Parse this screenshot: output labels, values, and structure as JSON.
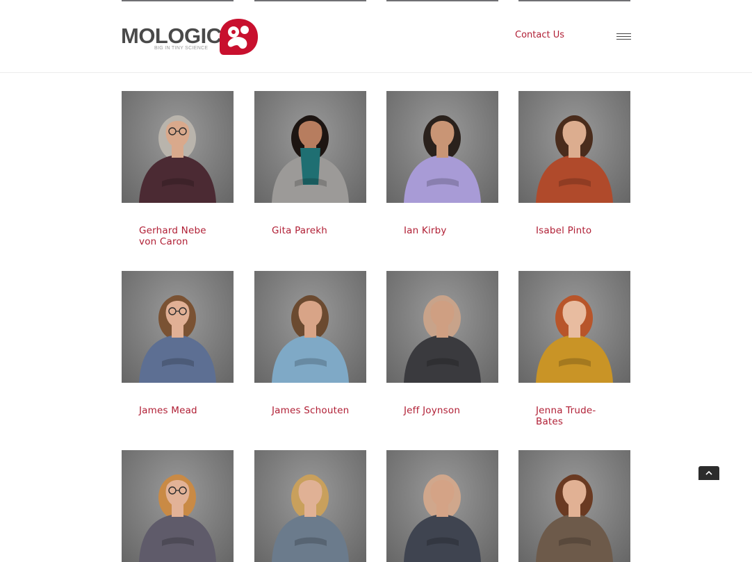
{
  "header": {
    "logo": {
      "wordmark": "MOLOGIC",
      "tagline": "BIG IN TINY SCIENCE",
      "brand_color": "#c8102e"
    },
    "nav": {
      "contact_label": "Contact Us",
      "menu_icon": "hamburger-icon"
    }
  },
  "team": {
    "rows": [
      {
        "members": [
          {
            "name": "Gerhard Nebe von Caron",
            "shirt": "#4b2a33",
            "hair": "#b9b4ac",
            "skin": "#d9a98c",
            "glasses": true
          },
          {
            "name": "Gita Parekh",
            "shirt": "#9c9a98",
            "hair": "#1d1512",
            "skin": "#b77d5f",
            "scarf": "#1f6f72"
          },
          {
            "name": "Ian Kirby",
            "shirt": "#a89bd6",
            "hair": "#2a211c",
            "skin": "#c99575"
          },
          {
            "name": "Isabel Pinto",
            "shirt": "#b04a2b",
            "hair": "#4a2c1c",
            "skin": "#dcad8f"
          }
        ]
      },
      {
        "members": [
          {
            "name": "James Mead",
            "shirt": "#5d6f93",
            "hair": "#7a5233",
            "skin": "#e1b095",
            "glasses": true
          },
          {
            "name": "James Schouten",
            "shirt": "#7fa9c6",
            "hair": "#6b4a30",
            "skin": "#d8a487"
          },
          {
            "name": "Jeff Joynson",
            "shirt": "#3a3a3e",
            "hair": "#c8a38a",
            "skin": "#cf9f82"
          },
          {
            "name": "Jenna Trude-Bates",
            "shirt": "#c99426",
            "hair": "#b8552a",
            "skin": "#e8bca0"
          }
        ]
      },
      {
        "members": [
          {
            "name": "",
            "shirt": "#5f5b6a",
            "hair": "#c98a45",
            "skin": "#e2b297",
            "glasses": true
          },
          {
            "name": "",
            "shirt": "#6b7b8c",
            "hair": "#c9a05c",
            "skin": "#e0b195"
          },
          {
            "name": "",
            "shirt": "#3f4450",
            "hair": "#d0a78c",
            "skin": "#d4a386"
          },
          {
            "name": "",
            "shirt": "#6d5a4a",
            "hair": "#6a3a22",
            "skin": "#e1b194"
          }
        ]
      }
    ]
  },
  "ui": {
    "back_to_top_icon": "chevron-up-icon"
  }
}
